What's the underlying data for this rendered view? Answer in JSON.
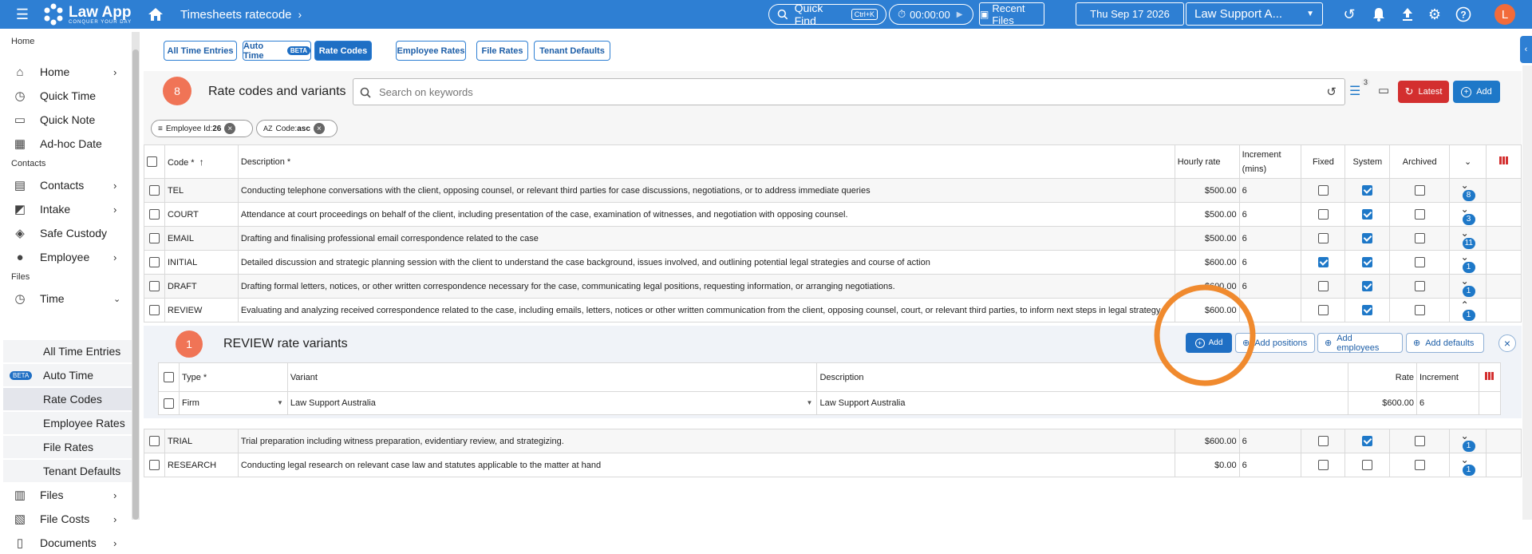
{
  "topbar": {
    "logo_name": "Law App",
    "logo_tagline": "CONQUER YOUR DAY",
    "breadcrumb": "Timesheets ratecode",
    "quick_find": "Quick Find",
    "shortcut": "Ctrl+K",
    "timer": "00:00:00",
    "recent_files": "Recent Files",
    "date": "Thu Sep 17 2026",
    "tenant": "Law Support A...",
    "avatar": "L"
  },
  "sidebar": {
    "sections": [
      "Home",
      "Contacts",
      "Files"
    ],
    "items": [
      {
        "label": "Home",
        "icon": "home-icon"
      },
      {
        "label": "Quick Time",
        "icon": "stopwatch-icon"
      },
      {
        "label": "Quick Note",
        "icon": "note-icon"
      },
      {
        "label": "Ad-hoc Date",
        "icon": "calendar-icon"
      },
      {
        "label": "Contacts",
        "icon": "contacts-icon"
      },
      {
        "label": "Intake",
        "icon": "intake-icon"
      },
      {
        "label": "Safe Custody",
        "icon": "safe-icon"
      },
      {
        "label": "Employee",
        "icon": "employee-icon"
      },
      {
        "label": "Time",
        "icon": "stopwatch-icon"
      },
      {
        "label": "All Time Entries"
      },
      {
        "label": "Auto Time",
        "badge": "BETA"
      },
      {
        "label": "Rate Codes"
      },
      {
        "label": "Employee Rates"
      },
      {
        "label": "File Rates"
      },
      {
        "label": "Tenant Defaults"
      },
      {
        "label": "Files",
        "icon": "files-icon"
      },
      {
        "label": "File Costs",
        "icon": "costs-icon"
      },
      {
        "label": "Documents",
        "icon": "documents-icon"
      }
    ]
  },
  "tabs": [
    {
      "label": "All Time Entries"
    },
    {
      "label": "Auto Time",
      "badge": "BETA"
    },
    {
      "label": "Rate Codes"
    },
    {
      "label": "Employee Rates"
    },
    {
      "label": "File Rates"
    },
    {
      "label": "Tenant Defaults"
    }
  ],
  "panel": {
    "count": "8",
    "title": "Rate codes and variants",
    "search_placeholder": "Search on keywords",
    "filter_count": "3",
    "latest": "Latest",
    "add": "Add",
    "chips": [
      {
        "label": "Employee Id:",
        "value": "26"
      },
      {
        "label": "Code:",
        "value": "asc"
      }
    ]
  },
  "columns": {
    "code": "Code *",
    "description": "Description *",
    "hourly_rate": "Hourly rate",
    "increment_1": "Increment",
    "increment_2": "(mins)",
    "fixed": "Fixed",
    "system": "System",
    "archived": "Archived"
  },
  "rows": [
    {
      "code": "TEL",
      "description": "Conducting telephone conversations with the client, opposing counsel, or relevant third parties for case discussions, negotiations, or to address immediate queries",
      "rate": "$500.00",
      "inc": "6",
      "fixed": false,
      "system": true,
      "archived": false,
      "count": "8"
    },
    {
      "code": "COURT",
      "description": "Attendance at court proceedings on behalf of the client, including presentation of the case, examination of witnesses, and negotiation with opposing counsel.",
      "rate": "$500.00",
      "inc": "6",
      "fixed": false,
      "system": true,
      "archived": false,
      "count": "3"
    },
    {
      "code": "EMAIL",
      "description": "Drafting and finalising professional email correspondence related to the case",
      "rate": "$500.00",
      "inc": "6",
      "fixed": false,
      "system": true,
      "archived": false,
      "count": "11"
    },
    {
      "code": "INITIAL",
      "description": "Detailed discussion and strategic planning session with the client to understand the case background, issues involved, and outlining potential legal strategies and course of action",
      "rate": "$600.00",
      "inc": "6",
      "fixed": true,
      "system": true,
      "archived": false,
      "count": "1"
    },
    {
      "code": "DRAFT",
      "description": "Drafting formal letters, notices, or other written correspondence necessary for the case, communicating legal positions, requesting information, or arranging negotiations.",
      "rate": "$600.00",
      "inc": "6",
      "fixed": false,
      "system": true,
      "archived": false,
      "count": "1"
    },
    {
      "code": "REVIEW",
      "description": "Evaluating and analyzing received correspondence related to the case, including emails, letters, notices or other written communication from the client, opposing counsel, court, or relevant third parties, to inform next steps in legal strategy",
      "rate": "$600.00",
      "inc": "",
      "fixed": false,
      "system": true,
      "archived": false,
      "count": "1"
    },
    {
      "code": "TRIAL",
      "description": "Trial preparation including witness preparation, evidentiary review, and strategizing.",
      "rate": "$600.00",
      "inc": "6",
      "fixed": false,
      "system": true,
      "archived": false,
      "count": "1"
    },
    {
      "code": "RESEARCH",
      "description": "Conducting legal research on relevant case law and statutes applicable to the matter at hand",
      "rate": "$0.00",
      "inc": "6",
      "fixed": false,
      "system": false,
      "archived": false,
      "count": "1"
    }
  ],
  "variants": {
    "count": "1",
    "title": "REVIEW rate variants",
    "add": "Add",
    "add_positions": "Add positions",
    "add_employees": "Add employees",
    "add_defaults": "Add defaults",
    "columns": {
      "type": "Type *",
      "variant": "Variant",
      "description": "Description",
      "rate": "Rate",
      "increment": "Increment"
    },
    "rows": [
      {
        "type": "Firm",
        "variant": "Law Support Australia",
        "description": "Law Support Australia",
        "rate": "$600.00",
        "inc": "6"
      }
    ]
  },
  "colors": {
    "primary": "#2e7fd3",
    "accent": "#f07456",
    "latest": "#d32f2f",
    "highlight": "#f08a2e"
  }
}
